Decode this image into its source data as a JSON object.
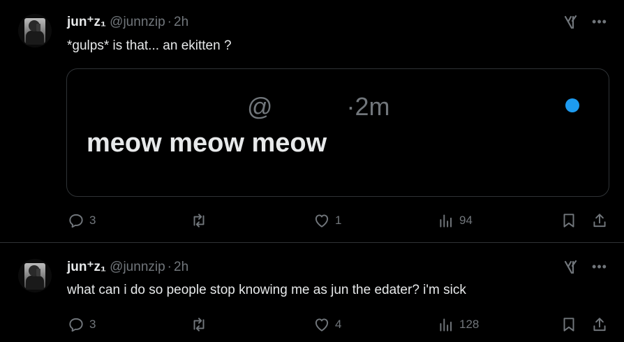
{
  "tweets": [
    {
      "author": {
        "name": "jun⁺z₁",
        "handle": "@junnzip",
        "time": "2h"
      },
      "text": "*gulps* is that... an ekitten ?",
      "quote": {
        "handle": "@",
        "time": "·2m",
        "text": "meow meow meow"
      },
      "stats": {
        "replies": "3",
        "reposts": "",
        "likes": "1",
        "views": "94"
      }
    },
    {
      "author": {
        "name": "jun⁺z₁",
        "handle": "@junnzip",
        "time": "2h"
      },
      "text": "what can i do so people stop knowing me as jun the edater? i'm sick",
      "stats": {
        "replies": "3",
        "reposts": "",
        "likes": "4",
        "views": "128"
      }
    }
  ],
  "colors": {
    "background": "#000000",
    "text": "#e7e9ea",
    "muted": "#71767b",
    "accent": "#1d9bf0",
    "border": "#2f3336"
  }
}
